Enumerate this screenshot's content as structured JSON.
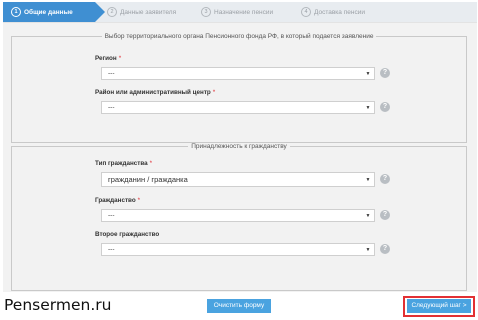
{
  "steps": [
    {
      "num": "1",
      "label": "Общие данные"
    },
    {
      "num": "2",
      "label": "Данные заявителя"
    },
    {
      "num": "3",
      "label": "Назначение пенсии"
    },
    {
      "num": "4",
      "label": "Доставка пенсии"
    }
  ],
  "group1": {
    "legend": "Выбор территориального органа Пенсионного фонда РФ, в который подается заявление",
    "region": {
      "label": "Регион",
      "required": "*",
      "value": "---"
    },
    "district": {
      "label": "Район или административный центр",
      "required": "*",
      "value": "---"
    }
  },
  "group2": {
    "legend": "Принадлежность к гражданству",
    "citizenship_type": {
      "label": "Тип гражданства",
      "required": "*",
      "value": "гражданин / гражданка"
    },
    "citizenship": {
      "label": "Гражданство",
      "required": "*",
      "value": "---"
    },
    "second_citizenship": {
      "label": "Второе гражданство",
      "value": "---"
    }
  },
  "help_glyph": "?",
  "arrow_glyph": "▼",
  "buttons": {
    "clear": "Очистить форму",
    "next": "Следующий шаг >"
  },
  "watermark": "Pensermen.ru",
  "colors": {
    "accent": "#3f8fd2",
    "button": "#4aa3e0",
    "highlight": "#e23033",
    "required": "#e0262d"
  }
}
